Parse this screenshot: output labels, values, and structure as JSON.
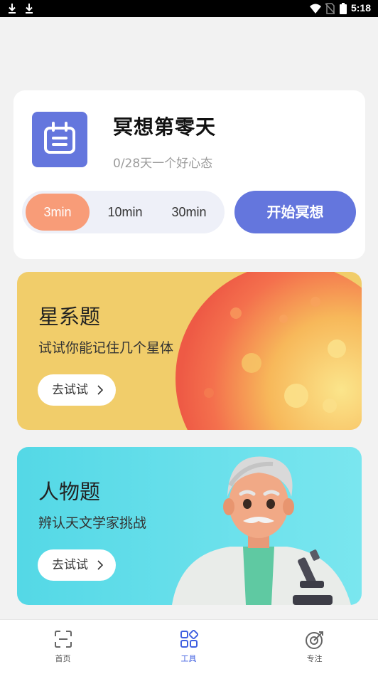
{
  "status_bar": {
    "time": "5:18"
  },
  "meditation": {
    "title": "冥想第零天",
    "subtitle": "0/28天一个好心态",
    "durations": [
      "3min",
      "10min",
      "30min"
    ],
    "selected_duration": "3min",
    "start_label": "开始冥想"
  },
  "topics": [
    {
      "title": "星系题",
      "subtitle": "试试你能记住几个星体",
      "button": "去试试"
    },
    {
      "title": "人物题",
      "subtitle": "辨认天文学家挑战",
      "button": "去试试"
    }
  ],
  "tabs": [
    {
      "label": "首页",
      "icon": "scan-icon"
    },
    {
      "label": "工具",
      "icon": "grid-icon"
    },
    {
      "label": "专注",
      "icon": "target-icon"
    }
  ],
  "active_tab": "工具",
  "colors": {
    "accent": "#6476dd",
    "selected_duration": "#f89c78",
    "star_card": "#f1cd6a",
    "person_card": "#54d8e6",
    "active_tab": "#3f5fe0"
  }
}
